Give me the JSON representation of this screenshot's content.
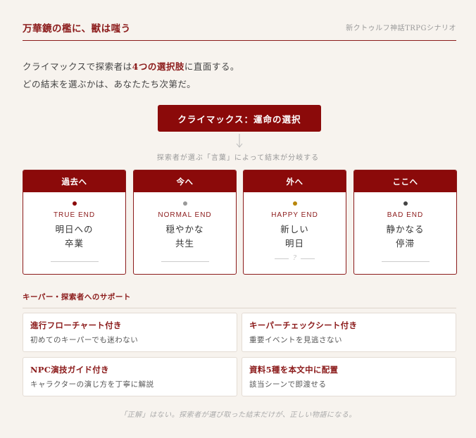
{
  "header": {
    "title": "万華鏡の檻に、獣は嗤う",
    "subtitle": "新クトゥルフ神話TRPGシナリオ"
  },
  "intro": {
    "line1_pre": "クライマックスで探索者は",
    "line1_em": "4つの選択肢",
    "line1_post": "に直面する。",
    "line2": "どの結末を選ぶかは、あなたたち次第だ。"
  },
  "climax": {
    "label": "クライマックス：運命の選択",
    "branch_note": "探索者が選ぶ「言葉」によって結末が分岐する"
  },
  "endings": [
    {
      "heading": "過去へ",
      "type": "TRUE END",
      "line1": "明日への",
      "line2": "卒業",
      "dot_color": "#8b0a0a",
      "foot_mark": ""
    },
    {
      "heading": "今へ",
      "type": "NORMAL END",
      "line1": "穏やかな",
      "line2": "共生",
      "dot_color": "#999999",
      "foot_mark": ""
    },
    {
      "heading": "外へ",
      "type": "HAPPY END",
      "line1": "新しい",
      "line2": "明日",
      "dot_color": "#b8860b",
      "foot_mark": "?"
    },
    {
      "heading": "ここへ",
      "type": "BAD END",
      "line1": "静かなる",
      "line2": "停滞",
      "dot_color": "#444444",
      "foot_mark": ""
    }
  ],
  "support": {
    "title": "キーパー・探索者へのサポート",
    "cards": [
      {
        "title": "進行フローチャート付き",
        "desc": "初めてのキーパーでも迷わない"
      },
      {
        "title": "キーパーチェックシート付き",
        "desc": "重要イベントを見逃さない"
      },
      {
        "title": "NPC演技ガイド付き",
        "desc": "キャラクターの演じ方を丁寧に解説"
      },
      {
        "title": "資料5種を本文中に配置",
        "desc": "該当シーンで即渡せる"
      }
    ]
  },
  "footer": {
    "note": "「正解」はない。探索者が選び取った結末だけが、正しい物語になる。"
  }
}
